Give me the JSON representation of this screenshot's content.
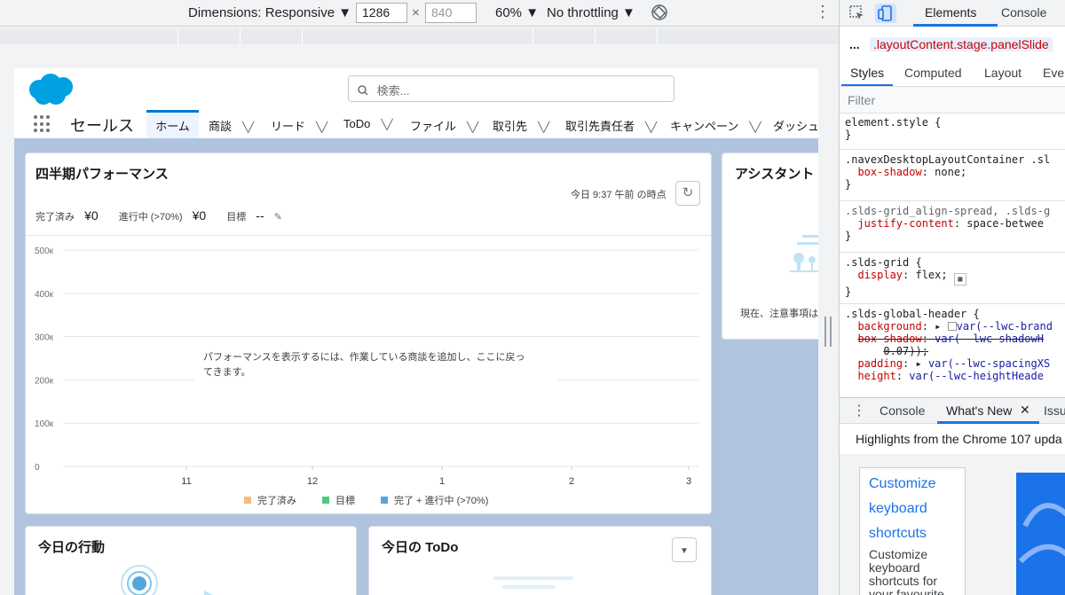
{
  "device_toolbar": {
    "dimensions_label": "Dimensions: Responsive",
    "width_value": "1286",
    "times": "×",
    "height_value": "840",
    "zoom": "60%",
    "throttling": "No throttling"
  },
  "app": {
    "search_placeholder": "検索...",
    "app_name": "セールス",
    "nav_tabs": [
      {
        "label": "ホーム",
        "active": true
      },
      {
        "label": "商談"
      },
      {
        "label": "リード"
      },
      {
        "label": "ToDo"
      },
      {
        "label": "ファイル"
      },
      {
        "label": "取引先"
      },
      {
        "label": "取引先責任者"
      },
      {
        "label": "キャンペーン"
      },
      {
        "label": "ダッシュボ"
      }
    ]
  },
  "performance": {
    "title": "四半期パフォーマンス",
    "as_of": "今日 9:37 午前 の時点",
    "closed_label": "完了済み",
    "closed_value": "¥0",
    "open_label": "進行中 (>70%)",
    "open_value": "¥0",
    "goal_label": "目標",
    "goal_value": "--",
    "empty_message_line1": "パフォーマンスを表示するには、作業している商談を追加し、ここに戻っ",
    "empty_message_line2": "てきます。"
  },
  "chart_data": {
    "type": "line",
    "y_ticks": [
      "500к",
      "400к",
      "300к",
      "200к",
      "100к",
      "0"
    ],
    "x_ticks": [
      "11",
      "12",
      "1",
      "2",
      "3"
    ],
    "ylim": [
      0,
      500000
    ],
    "series": [
      {
        "name": "完了済み",
        "color": "#f4bc7d",
        "values": []
      },
      {
        "name": "目標",
        "color": "#4bca81",
        "values": []
      },
      {
        "name": "完了 + 進行中 (>70%)",
        "color": "#54a7dc",
        "values": []
      }
    ],
    "grid": true,
    "legend_position": "bottom"
  },
  "assistant": {
    "title": "アシスタント",
    "message": "現在、注意事項はありません"
  },
  "today_events": {
    "title": "今日の行動"
  },
  "today_tasks": {
    "title": "今日の ToDo"
  },
  "devtools": {
    "tabs": [
      "Elements",
      "Console"
    ],
    "breadcrumb": "...",
    "breadcrumb_class": ".layoutContent.stage.panelSlide",
    "subtabs": [
      "Styles",
      "Computed",
      "Layout",
      "Event"
    ],
    "filter_placeholder": "Filter",
    "rules": [
      {
        "selector": "element.style {",
        "close": "}"
      },
      {
        "selector": ".navexDesktopLayoutContainer .sl",
        "prop": "box-shadow",
        "value": "none;",
        "close": "}"
      },
      {
        "selector": ".slds-grid_align-spread, .slds-g",
        "prop": "justify-content",
        "value": "space-betwee",
        "close": "}"
      },
      {
        "selector": ".slds-grid {",
        "prop": "display",
        "value": "flex;",
        "close": "}"
      },
      {
        "selector": ".slds-global-header {"
      }
    ],
    "header_props": [
      {
        "prop": "background",
        "value": "var(--lwc-brand"
      },
      {
        "prop": "box-shadow",
        "value": "var(--lwc-shadowH"
      },
      {
        "prop": "",
        "value": "0.07));"
      },
      {
        "prop": "padding",
        "value": "var(--lwc-spacingXS"
      },
      {
        "prop": "height",
        "value": "var(--lwc-heightHeade"
      }
    ],
    "drawer_tabs": [
      "Console",
      "What's New",
      "Issu"
    ],
    "whats_new_title": "Highlights from the Chrome 107 upda",
    "card_link": [
      "Customize",
      "keyboard",
      "shortcuts"
    ],
    "card_desc": [
      "Customize",
      "keyboard",
      "shortcuts for",
      "your favourite"
    ]
  }
}
